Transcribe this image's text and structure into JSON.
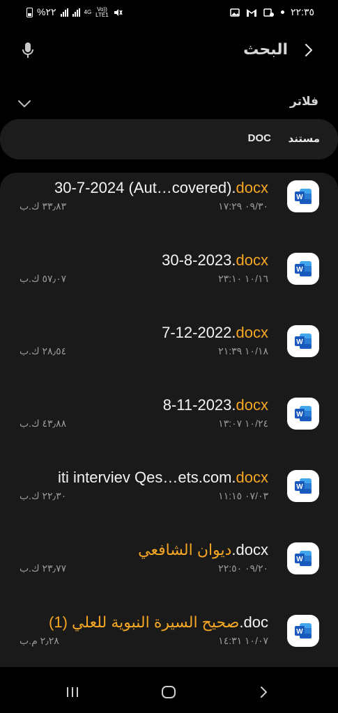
{
  "status_bar": {
    "time": "٢٢:٣٥",
    "battery_text": "%٢٢",
    "network": "4G",
    "volte_line1": "Vo))",
    "volte_line2": "LTE1"
  },
  "header": {
    "title": "البحث"
  },
  "filters": {
    "label": "فلاتر",
    "active_key": "مستند",
    "active_value": "DOC"
  },
  "colors": {
    "highlight": "#f5a623",
    "word_blue": "#185abd"
  },
  "files": [
    {
      "prefix": "30-7-2024 (Aut…covered).",
      "highlight": "docx",
      "suffix": "",
      "date": "٠٩/٣٠ ١٧:٢٩",
      "size": "٣٣٫٨٣ ك.ب"
    },
    {
      "prefix": "30-8-2023.",
      "highlight": "docx",
      "suffix": "",
      "date": "١٠/١٦ ٢٣:١٠",
      "size": "٥٧٫٠٧ ك.ب"
    },
    {
      "prefix": "7-12-2022.",
      "highlight": "docx",
      "suffix": "",
      "date": "١٠/١٨ ٢١:٣٩",
      "size": "٢٨٫٥٤ ك.ب"
    },
    {
      "prefix": "8-11-2023.",
      "highlight": "docx",
      "suffix": "",
      "date": "١٠/٢٤ ١٣:٠٧",
      "size": "٤٣٫٨٨ ك.ب"
    },
    {
      "prefix": "iti interviev Qes…ets.com.",
      "highlight": "docx",
      "suffix": "",
      "date": "٠٧/٠٣ ١١:١٥",
      "size": "٢٢٫٣٠ ك.ب"
    },
    {
      "prefix": "",
      "highlight": "ديوان الشافعي",
      "suffix": ".docx",
      "date": "٠٩/٢٠ ٢٢:٥٠",
      "size": "٢٣٫٧٧ ك.ب"
    },
    {
      "prefix": "",
      "highlight": "صحيح السيرة النبوية للعلي (1)",
      "suffix": ".doc",
      "date": "١٠/٠٧ ١٤:٣١",
      "size": "٢٫٢٨ م.ب"
    }
  ]
}
